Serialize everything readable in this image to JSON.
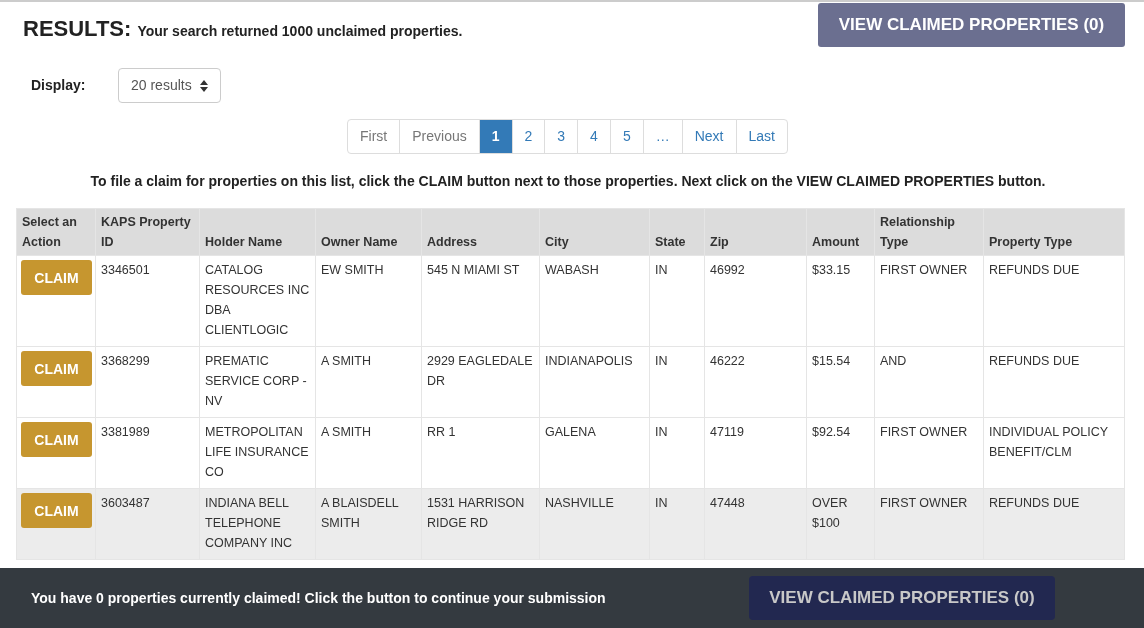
{
  "header": {
    "title": "RESULTS:",
    "summary": "Your search returned 1000 unclaimed properties.",
    "view_button": "VIEW CLAIMED PROPERTIES (0)"
  },
  "display": {
    "label": "Display:",
    "value": "20 results"
  },
  "pagination": [
    {
      "label": "First",
      "selected": false
    },
    {
      "label": "Previous",
      "selected": false
    },
    {
      "label": "1",
      "selected": true
    },
    {
      "label": "2",
      "selected": false
    },
    {
      "label": "3",
      "selected": false
    },
    {
      "label": "4",
      "selected": false
    },
    {
      "label": "5",
      "selected": false
    },
    {
      "label": "…",
      "selected": false
    },
    {
      "label": "Next",
      "selected": false
    },
    {
      "label": "Last",
      "selected": false
    }
  ],
  "instructions": "To file a claim for properties on this list, click the CLAIM button next to those properties. Next click on the VIEW CLAIMED PROPERTIES button.",
  "table": {
    "columns": [
      "Select an Action",
      "KAPS Property ID",
      "Holder Name",
      "Owner Name",
      "Address",
      "City",
      "State",
      "Zip",
      "Amount",
      "Relationship Type",
      "Property Type"
    ],
    "rows": [
      {
        "highlighted": false,
        "cells": [
          "CLAIM",
          "3346501",
          "CATALOG RESOURCES INC DBA CLIENTLOGIC",
          "EW SMITH",
          "545 N MIAMI ST",
          "WABASH",
          "IN",
          "46992",
          "$33.15",
          "FIRST OWNER",
          "REFUNDS DUE"
        ]
      },
      {
        "highlighted": false,
        "cells": [
          "CLAIM",
          "3368299",
          "PREMATIC SERVICE CORP - NV",
          "A SMITH",
          "2929 EAGLEDALE DR",
          "INDIANAPOLIS",
          "IN",
          "46222",
          "$15.54",
          "AND",
          "REFUNDS DUE"
        ]
      },
      {
        "highlighted": false,
        "cells": [
          "CLAIM",
          "3381989",
          "METROPOLITAN LIFE INSURANCE CO",
          "A SMITH",
          "RR 1",
          "GALENA",
          "IN",
          "47119",
          "$92.54",
          "FIRST OWNER",
          "INDIVIDUAL POLICY BENEFIT/CLM"
        ]
      },
      {
        "highlighted": true,
        "cells": [
          "CLAIM",
          "3603487",
          "INDIANA BELL TELEPHONE COMPANY INC",
          "A BLAISDELL SMITH",
          "1531 HARRISON RIDGE RD",
          "NASHVILLE",
          "IN",
          "47448",
          "OVER $100",
          "FIRST OWNER",
          "REFUNDS DUE"
        ]
      }
    ]
  },
  "footer": {
    "message": "You have 0 properties currently claimed! Click the button to continue your submission",
    "view_button": "VIEW CLAIMED PROPERTIES (0)"
  }
}
